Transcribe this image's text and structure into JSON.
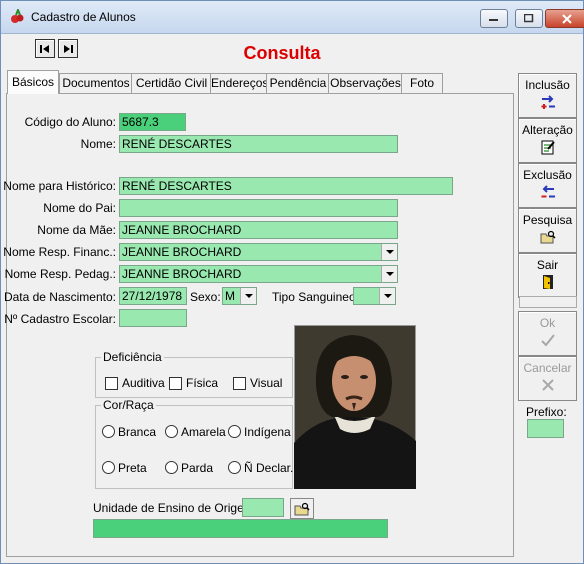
{
  "window": {
    "title": "Cadastro de Alunos"
  },
  "mode_label": "Consulta",
  "tabs": [
    "Básicos",
    "Documentos",
    "Certidão Civil",
    "Endereços",
    "Pendência",
    "Observações",
    "Foto"
  ],
  "form": {
    "codigo": {
      "label": "Código do Aluno:",
      "value": "5687.3"
    },
    "nome": {
      "label": "Nome:",
      "value": "RENÉ DESCARTES"
    },
    "nome_historico": {
      "label": "Nome para Histórico:",
      "value": "RENÉ DESCARTES"
    },
    "nome_pai": {
      "label": "Nome do Pai:",
      "value": ""
    },
    "nome_mae": {
      "label": "Nome da Mãe:",
      "value": "JEANNE BROCHARD"
    },
    "resp_financ": {
      "label": "Nome Resp. Financ.:",
      "value": "JEANNE BROCHARD"
    },
    "resp_pedag": {
      "label": "Nome Resp. Pedag.:",
      "value": "JEANNE BROCHARD"
    },
    "data_nasc": {
      "label": "Data de Nascimento:",
      "value": "27/12/1978"
    },
    "sexo": {
      "label": "Sexo:",
      "value": "M"
    },
    "tipo_sanguineo": {
      "label": "Tipo Sanguineo:",
      "value": ""
    },
    "cadastro_escolar": {
      "label": "Nº Cadastro Escolar:",
      "value": ""
    },
    "unidade_origem": {
      "label": "Unidade de Ensino de Origem:",
      "code": "",
      "name": ""
    }
  },
  "deficiencia": {
    "title": "Deficiência",
    "options": [
      "Auditiva",
      "Física",
      "Visual"
    ]
  },
  "cor_raca": {
    "title": "Cor/Raça",
    "options": [
      "Branca",
      "Amarela",
      "Indígena",
      "Preta",
      "Parda",
      "Ñ Declar."
    ]
  },
  "sidebar": {
    "inclusao": "Inclusão",
    "alteracao": "Alteração",
    "exclusao": "Exclusão",
    "pesquisa": "Pesquisa",
    "sair": "Sair",
    "ok": "Ok",
    "cancelar": "Cancelar",
    "prefixo": "Prefixo:"
  }
}
